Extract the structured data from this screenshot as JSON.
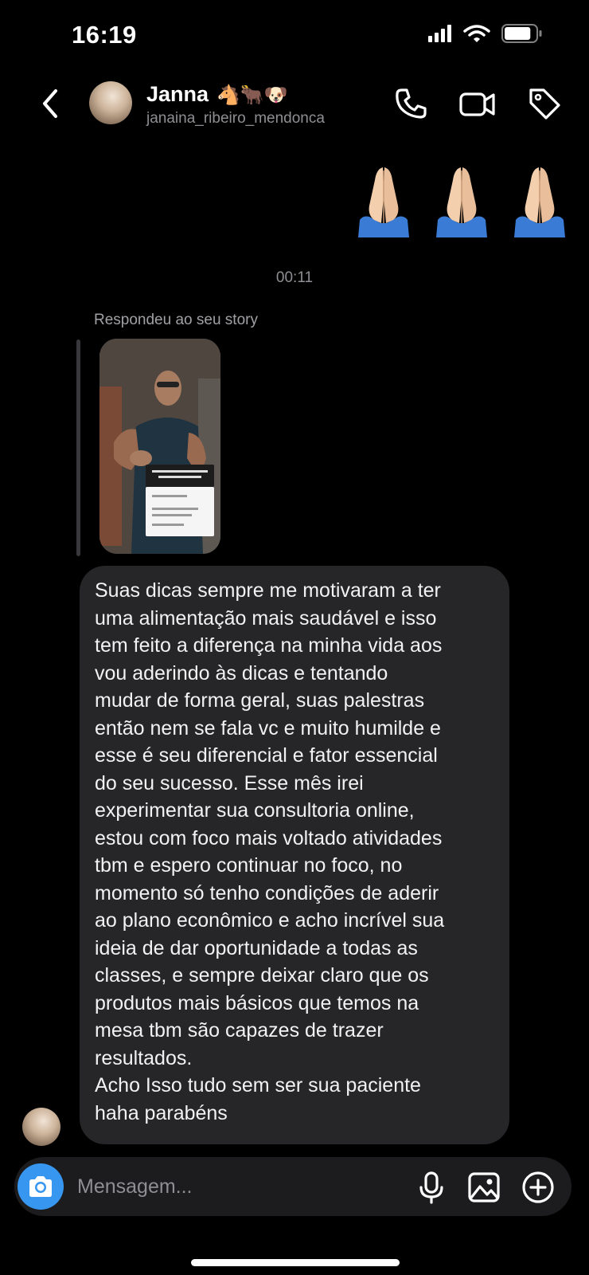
{
  "status_bar": {
    "time": "16:19",
    "battery_level": 0.85
  },
  "header": {
    "contact_name": "Janna",
    "name_emojis": "🐴🐂🐶",
    "username": "janaina_ribeiro_mendonca",
    "icons": {
      "back": "chevron-left-icon",
      "call": "phone-icon",
      "video": "video-camera-icon",
      "tag": "tag-icon"
    }
  },
  "thread": {
    "sent_reaction": "🙏🙏🙏",
    "timestamp": "00:11",
    "reply_label": "Respondeu ao seu story",
    "message_lines": [
      "Suas dicas sempre me motivaram a ter",
      "uma alimentação mais saudável e isso",
      "tem feito a diferença na minha vida aos",
      "vou aderindo às dicas e tentando",
      "mudar de forma geral,  suas palestras",
      "então nem se fala vc e muito humilde e",
      "esse é seu diferencial e fator essencial",
      "do seu sucesso. Esse mês irei",
      "experimentar sua consultoria online,",
      "estou com foco mais voltado atividades",
      "tbm e espero continuar no foco, no",
      "momento só tenho condições de aderir",
      "ao plano econômico e acho incrível sua",
      "ideia de dar oportunidade a todas as",
      "classes, e sempre deixar claro que os",
      "produtos mais básicos que temos na",
      "mesa tbm são capazes de trazer",
      "resultados.",
      "Acho Isso tudo sem ser sua paciente",
      "haha parabéns"
    ]
  },
  "composer": {
    "placeholder": "Mensagem...",
    "value": "",
    "icons": {
      "camera": "camera-icon",
      "mic": "microphone-icon",
      "gallery": "image-icon",
      "add": "plus-circle-icon"
    },
    "camera_button_color": "#3797f0"
  }
}
